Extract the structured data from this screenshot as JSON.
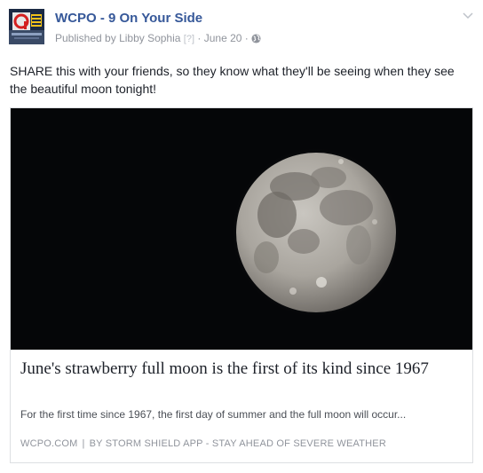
{
  "post": {
    "page_name": "WCPO - 9 On Your Side",
    "publisher_prefix": "Published by",
    "publisher_name": "Libby Sophia",
    "help_marker": "[?]",
    "date": "June 20",
    "separator": "·",
    "message": "SHARE this with your friends, so they know what they'll be seeing when they see the beautiful moon tonight!",
    "avatar_icon": "wcpo-9-logo-icon",
    "privacy_icon": "globe-icon",
    "menu_icon": "chevron-down-icon"
  },
  "link_card": {
    "image_icon": "full-moon-photo",
    "title": "June's strawberry full moon is the first of its kind since 1967",
    "description": "For the first time since 1967, the first day of summer and the full moon will occur...",
    "domain": "WCPO.COM",
    "source_separator": "|",
    "byline": "BY STORM SHIELD APP - STAY AHEAD OF SEVERE WEATHER"
  },
  "colors": {
    "page_name": "#365899",
    "meta": "#90949c",
    "text": "#1d2129",
    "card_border": "#dddfe2",
    "image_background": "#050608"
  }
}
